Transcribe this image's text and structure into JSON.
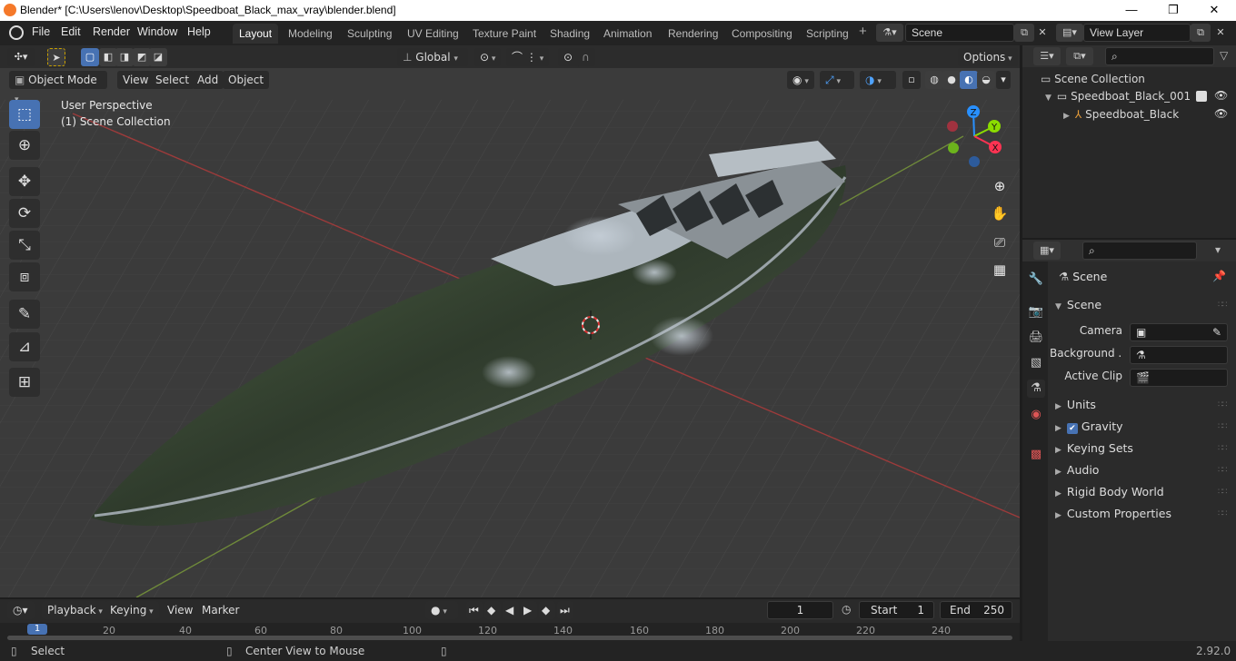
{
  "window": {
    "title": "Blender* [C:\\Users\\lenov\\Desktop\\Speedboat_Black_max_vray\\blender.blend]",
    "minimize": "—",
    "maximize": "❐",
    "close": "✕"
  },
  "menu": [
    "File",
    "Edit",
    "Render",
    "Window",
    "Help"
  ],
  "workspaces": [
    "Layout",
    "Modeling",
    "Sculpting",
    "UV Editing",
    "Texture Paint",
    "Shading",
    "Animation",
    "Rendering",
    "Compositing",
    "Scripting"
  ],
  "scene_name": "Scene",
  "view_layer": "View Layer",
  "viewport": {
    "orientation": "Global",
    "options": "Options",
    "mode": "Object Mode",
    "header_menu": [
      "View",
      "Select",
      "Add",
      "Object"
    ],
    "perspective": "User Perspective",
    "collection": "(1) Scene Collection",
    "gizmo": {
      "z": "Z",
      "y": "Y",
      "x": "X"
    }
  },
  "outliner": {
    "root": "Scene Collection",
    "items": [
      {
        "label": "Speedboat_Black_001"
      },
      {
        "label": "Speedboat_Black"
      }
    ]
  },
  "properties": {
    "header": "Scene",
    "section": "Scene",
    "fields": [
      {
        "label": "Camera"
      },
      {
        "label": "Background ..."
      },
      {
        "label": "Active Clip"
      }
    ],
    "panels": [
      "Units",
      "Gravity",
      "Keying Sets",
      "Audio",
      "Rigid Body World",
      "Custom Properties"
    ]
  },
  "timeline": {
    "menus": [
      "Playback",
      "Keying",
      "View",
      "Marker"
    ],
    "current_frame": "1",
    "start_label": "Start",
    "start": "1",
    "end_label": "End",
    "end": "250",
    "ruler": [
      "1",
      "20",
      "40",
      "60",
      "80",
      "100",
      "120",
      "140",
      "160",
      "180",
      "200",
      "220",
      "240"
    ]
  },
  "status": {
    "left": "Select",
    "middle": "Center View to Mouse",
    "version": "2.92.0"
  },
  "colors": {
    "accent": "#4772b3",
    "x_axis": "#ff3352",
    "y_axis": "#8bdc00",
    "z_axis": "#2890ff"
  }
}
